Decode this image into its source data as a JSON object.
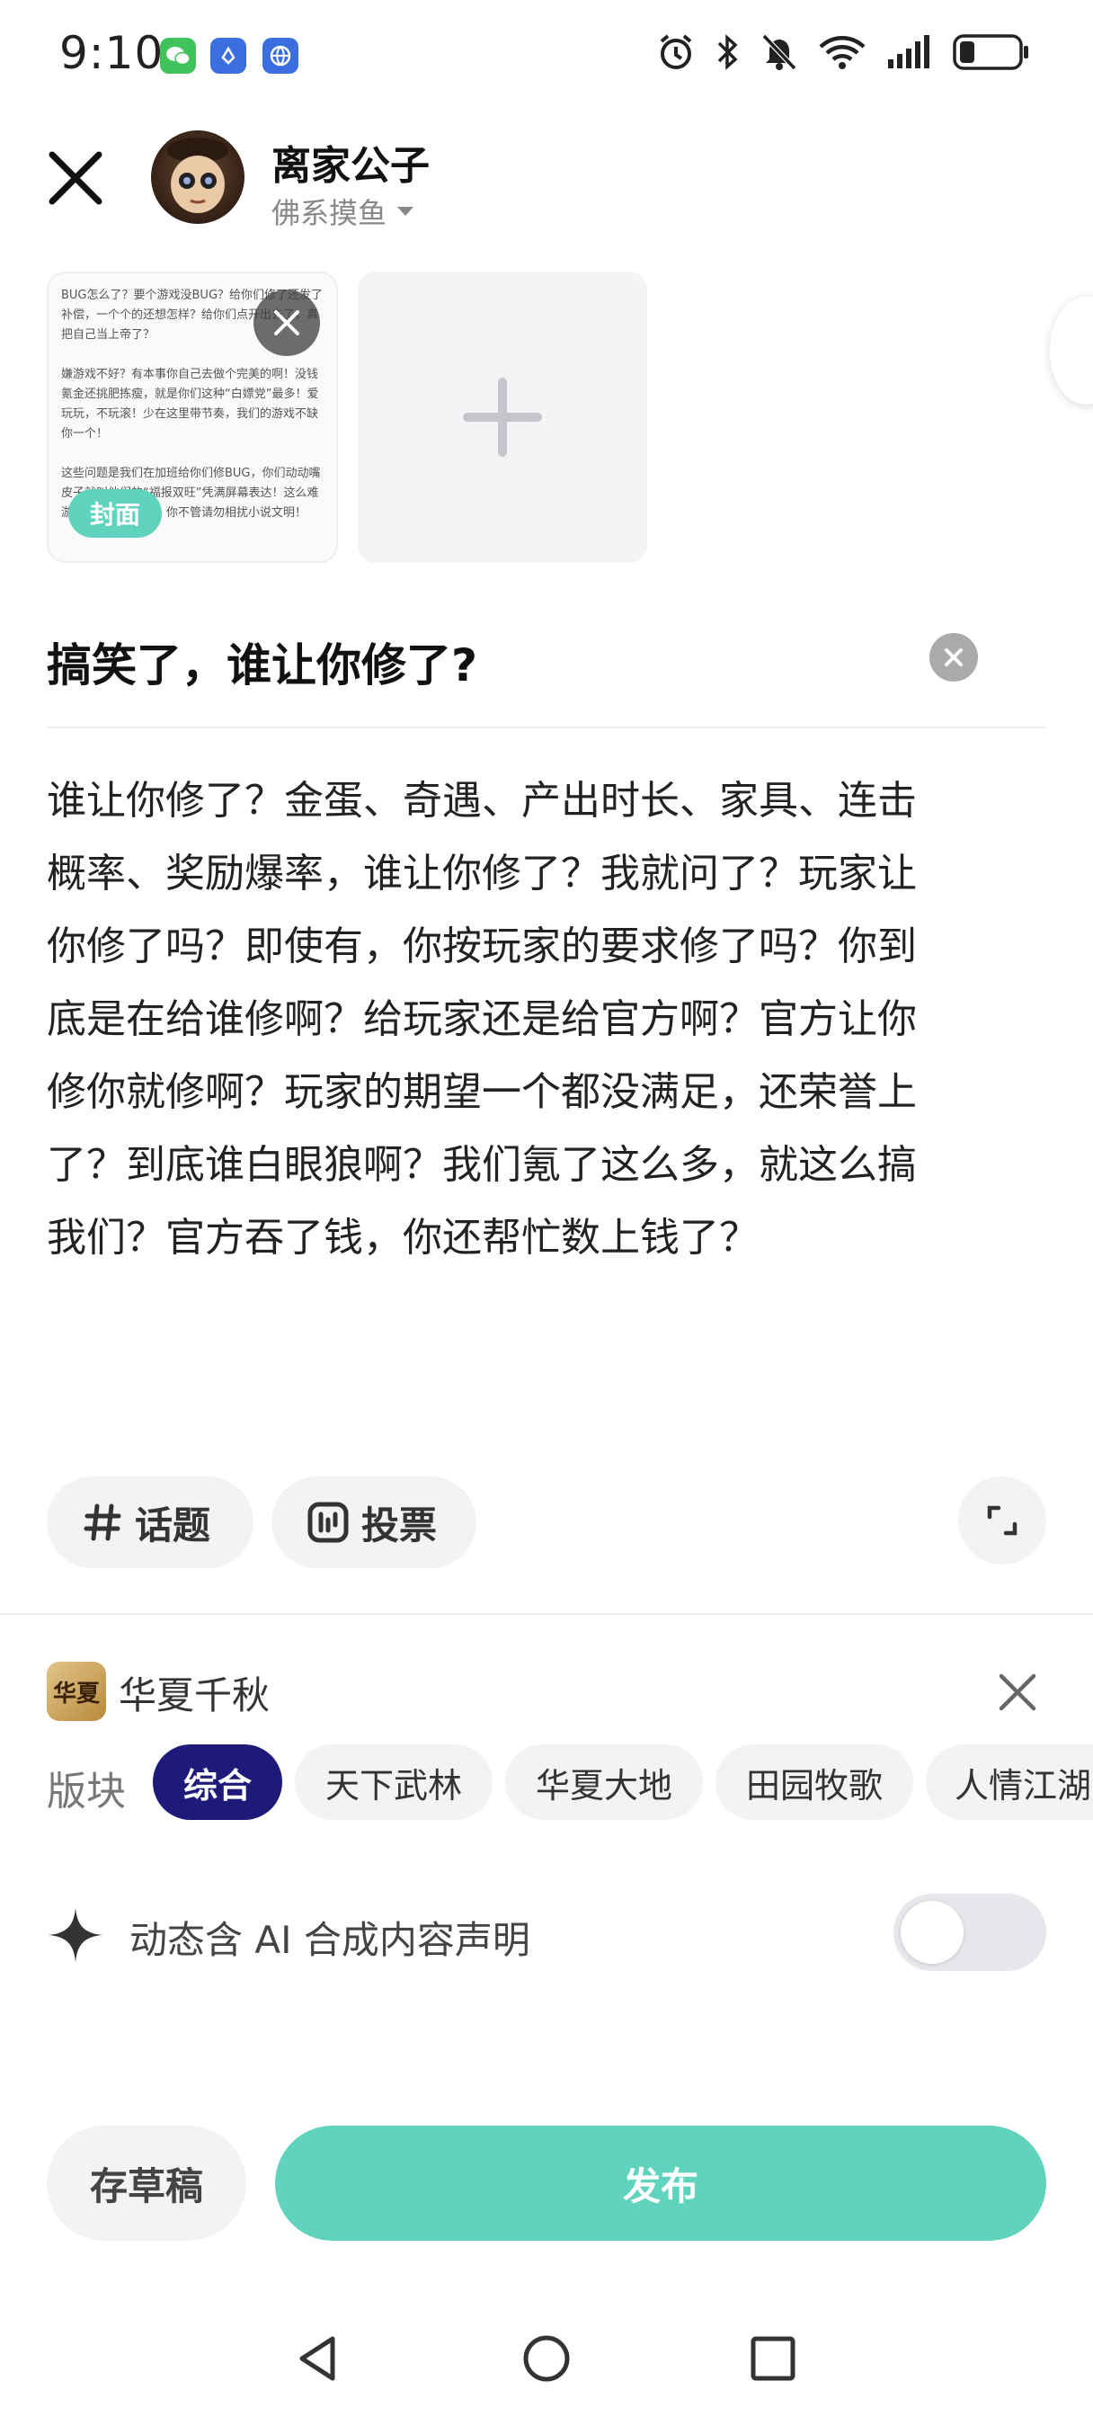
{
  "status_bar": {
    "time": "9:10",
    "app_icons": [
      "wechat-icon",
      "app-blue-icon",
      "browser-icon"
    ],
    "right_icons": [
      "alarm-icon",
      "bluetooth-icon",
      "mute-icon",
      "wifi-icon",
      "signal-icon",
      "battery-icon"
    ]
  },
  "header": {
    "username": "离家公子",
    "subtitle": "佛系摸鱼"
  },
  "images": {
    "thumb_text": "BUG怎么了？要个游戏没BUG？给你们修了还发了补偿，一个个的还想怎样？给你们点开出去了，真把自己当上帝了？\n\n嫌游戏不好？有本事你自己去做个完美的啊！没钱氪金还挑肥拣瘦，就是你们这种“白嫖党”最多！爱玩玩，不玩滚！少在这里带节奏，我们的游戏不缺你一个！\n\n这些问题是我们在加班给你们修BUG，你们动动嘴皮子就叫他们的“福报双旺”凭满屏幕表达！这么难游戏怎么办不厌的？你不管请勿相扰小说文明！",
    "cover_label": "封面"
  },
  "post": {
    "title": "搞笑了，谁让你修了?",
    "body": "谁让你修了？金蛋、奇遇、产出时长、家具、连击\n概率、奖励爆率，谁让你修了？我就问了？玩家让\n你修了吗？即使有，你按玩家的要求修了吗？你到\n底是在给谁修啊？给玩家还是给官方啊？官方让你\n修你就修啊？玩家的期望一个都没满足，还荣誉上\n了？到底谁白眼狼啊？我们氪了这么多，就这么搞\n我们？官方吞了钱，你还帮忙数上钱了？"
  },
  "tools": {
    "topic_label": "话题",
    "vote_label": "投票"
  },
  "game": {
    "icon_text": "华夏",
    "name": "华夏千秋"
  },
  "sections": {
    "label": "版块",
    "items": [
      "综合",
      "天下武林",
      "华夏大地",
      "田园牧歌",
      "人情江湖"
    ],
    "selected": "综合"
  },
  "ai_declaration": {
    "label": "动态含 AI 合成内容声明",
    "enabled": false
  },
  "actions": {
    "draft_label": "存草稿",
    "publish_label": "发布"
  },
  "colors": {
    "accent": "#5fd3bd",
    "section_active": "#1e1a7a"
  }
}
